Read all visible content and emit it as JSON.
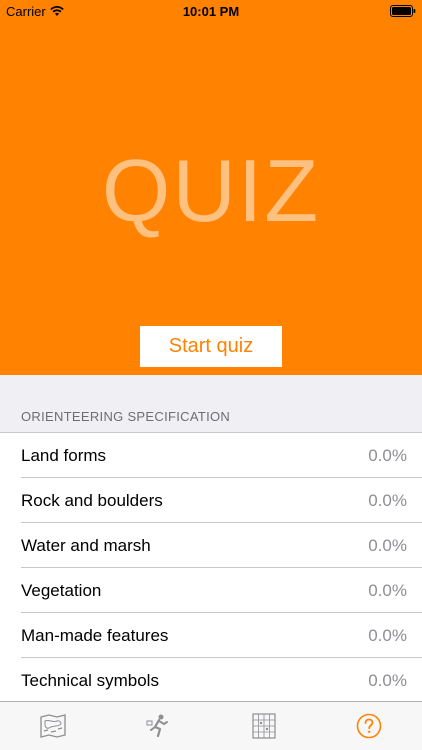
{
  "status_bar": {
    "carrier": "Carrier",
    "time": "10:01 PM"
  },
  "hero": {
    "title": "QUIZ",
    "start_button": "Start quiz",
    "background_color": "#ff8200"
  },
  "section": {
    "header": "ORIENTEERING SPECIFICATION",
    "items": [
      {
        "label": "Land forms",
        "value": "0.0%"
      },
      {
        "label": "Rock and boulders",
        "value": "0.0%"
      },
      {
        "label": "Water and marsh",
        "value": "0.0%"
      },
      {
        "label": "Vegetation",
        "value": "0.0%"
      },
      {
        "label": "Man-made features",
        "value": "0.0%"
      },
      {
        "label": "Technical symbols",
        "value": "0.0%"
      }
    ]
  },
  "tabbar": {
    "tabs": [
      {
        "icon": "map-icon"
      },
      {
        "icon": "runner-icon"
      },
      {
        "icon": "symbols-grid-icon"
      },
      {
        "icon": "help-icon",
        "active": true
      }
    ],
    "accent_color": "#ff8200"
  }
}
